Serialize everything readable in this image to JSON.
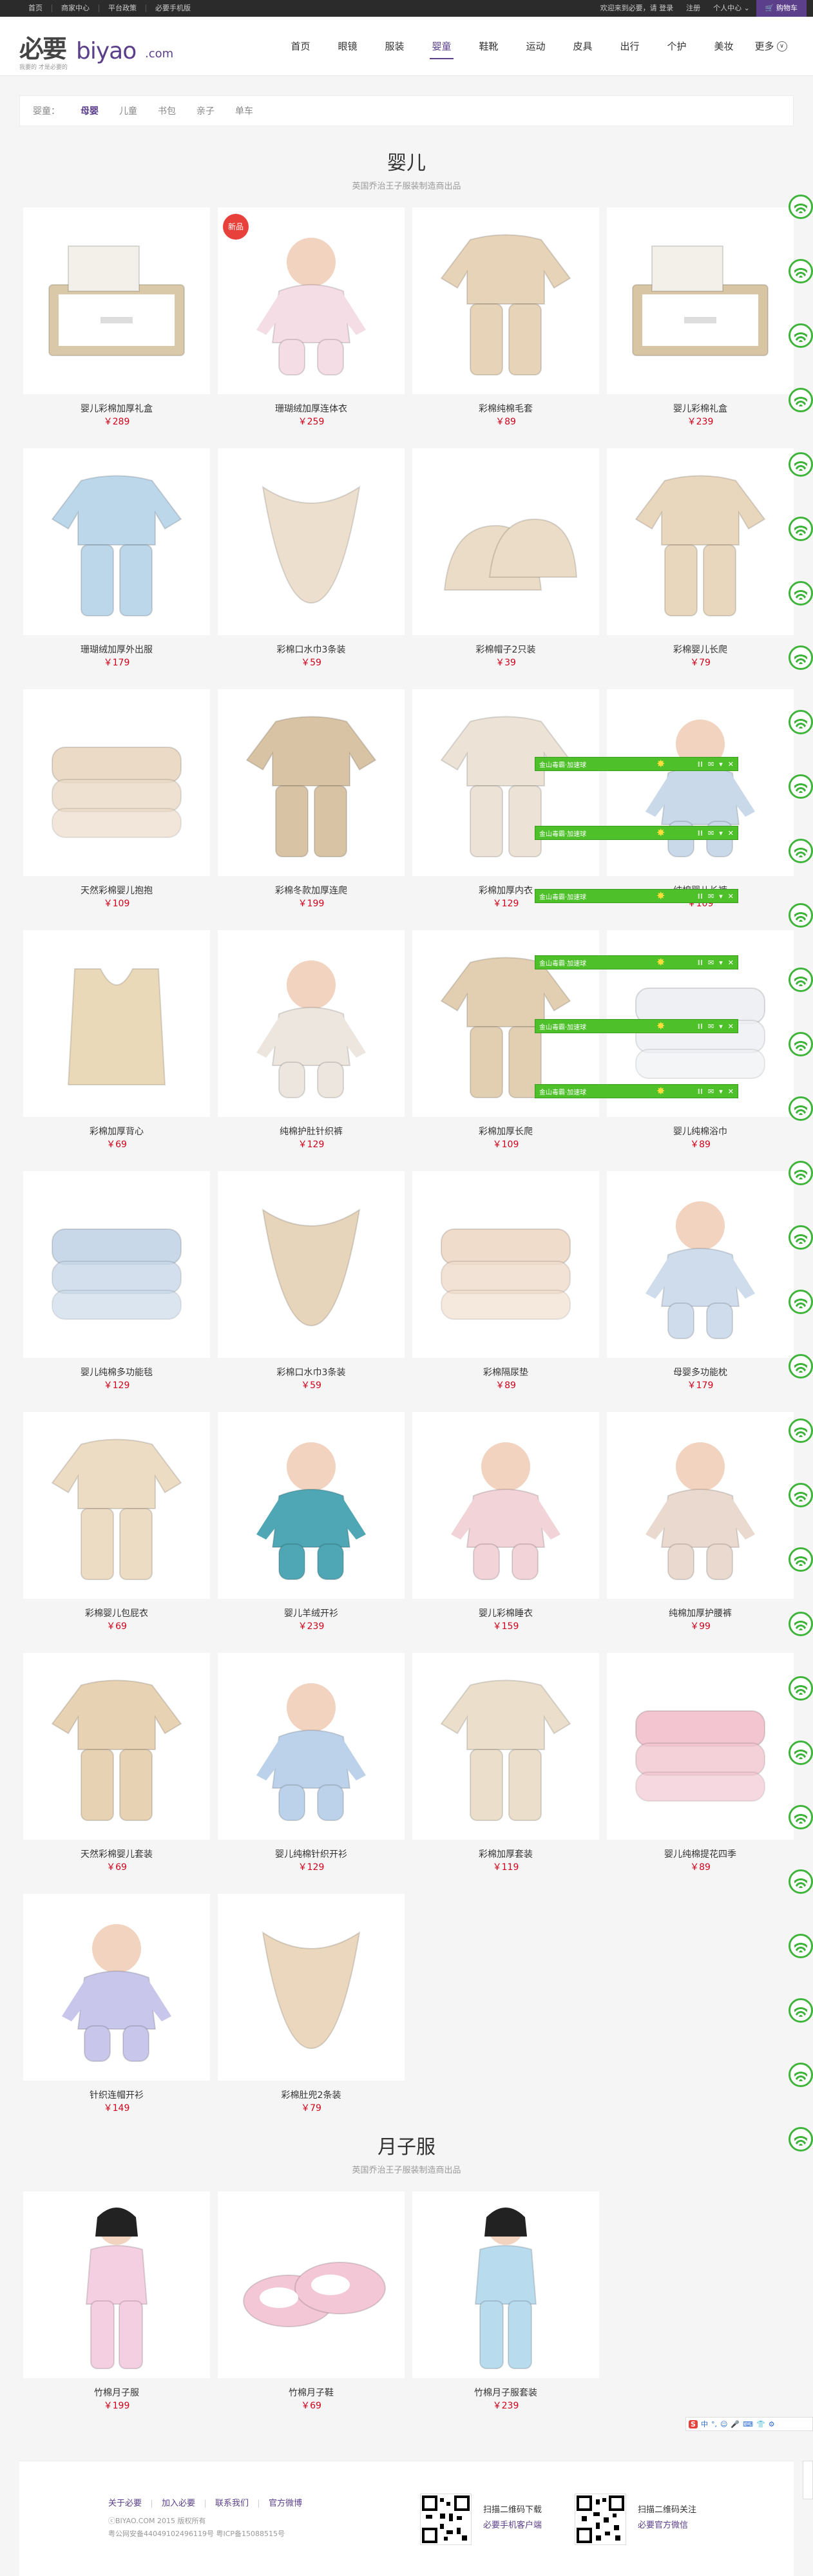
{
  "topbar": {
    "left": [
      "首页",
      "商家中心",
      "平台政策",
      "必要手机版"
    ],
    "right": [
      "欢迎来到必要，请  登录",
      "注册",
      "个人中心 ⌄"
    ],
    "cart": "🛒 购物车"
  },
  "logo": {
    "cn": "必要",
    "en": "biyao",
    "com": ".com",
    "sub": "我要的 才是必要的"
  },
  "nav": {
    "items": [
      "首页",
      "眼镜",
      "服装",
      "婴童",
      "鞋靴",
      "运动",
      "皮具",
      "出行",
      "个护",
      "美妆"
    ],
    "active": "婴童",
    "more": "更多"
  },
  "breadcrumb": {
    "label": "婴童：",
    "items": [
      "母婴",
      "儿童",
      "书包",
      "亲子",
      "单车"
    ],
    "active": "母婴"
  },
  "section1": {
    "title": "婴儿",
    "subtitle": "英国乔治王子服装制造商出品"
  },
  "section2": {
    "title": "月子服",
    "subtitle": "英国乔治王子服装制造商出品"
  },
  "badge_new": "新品",
  "products1": [
    {
      "name": "婴儿彩棉加厚礼盒",
      "price": "￥289",
      "icon": "gift-box",
      "color": "#d9c9a8"
    },
    {
      "name": "珊瑚绒加厚连体衣",
      "price": "￥259",
      "icon": "pink-onesie",
      "color": "#f4dde4",
      "badge": true
    },
    {
      "name": "彩棉纯棉毛套",
      "price": "￥89",
      "icon": "beige-set",
      "color": "#e6d3b8"
    },
    {
      "name": "婴儿彩棉礼盒",
      "price": "￥239",
      "icon": "gift-box",
      "color": "#d8c5a4"
    },
    {
      "name": "珊瑚绒加厚外出服",
      "price": "￥179",
      "icon": "blue-jacket",
      "color": "#bcd6ea"
    },
    {
      "name": "彩棉口水巾3条装",
      "price": "￥59",
      "icon": "bibs",
      "color": "#ecdfcd"
    },
    {
      "name": "彩棉帽子2只装",
      "price": "￥39",
      "icon": "hats",
      "color": "#eadcc6"
    },
    {
      "name": "彩棉婴儿长爬",
      "price": "￥79",
      "icon": "romper",
      "color": "#e8d6bd"
    },
    {
      "name": "天然彩棉婴儿抱抱",
      "price": "￥109",
      "icon": "wrap",
      "color": "#eadac6"
    },
    {
      "name": "彩棉冬款加厚连爬",
      "price": "￥199",
      "icon": "hooded-romper",
      "color": "#d8c3a5"
    },
    {
      "name": "彩棉加厚内衣",
      "price": "￥129",
      "icon": "underwear",
      "color": "#ece3d6"
    },
    {
      "name": "纯棉婴儿长裤",
      "price": "￥109",
      "icon": "baby-play",
      "color": "#c9d9ea"
    },
    {
      "name": "彩棉加厚背心",
      "price": "￥69",
      "icon": "vest",
      "color": "#ead9b8"
    },
    {
      "name": "纯棉护肚针织裤",
      "price": "￥129",
      "icon": "baby-hat",
      "color": "#ece6de"
    },
    {
      "name": "彩棉加厚长爬",
      "price": "￥109",
      "icon": "romper",
      "color": "#e2cfb2"
    },
    {
      "name": "婴儿纯棉浴巾",
      "price": "￥89",
      "icon": "towels",
      "color": "#eef0f4"
    },
    {
      "name": "婴儿纯棉多功能毯",
      "price": "￥129",
      "icon": "blankets",
      "color": "#c9d8e8"
    },
    {
      "name": "彩棉口水巾3条装",
      "price": "￥59",
      "icon": "bandana",
      "color": "#e6d4bb"
    },
    {
      "name": "彩棉隔尿垫",
      "price": "￥89",
      "icon": "pad",
      "color": "#f0dccb"
    },
    {
      "name": "母婴多功能枕",
      "price": "￥179",
      "icon": "pillow",
      "color": "#cfdcec"
    },
    {
      "name": "彩棉婴儿包屁衣",
      "price": "￥69",
      "icon": "bodysuit",
      "color": "#eddcc4"
    },
    {
      "name": "婴儿羊绒开衫",
      "price": "￥239",
      "icon": "teal-cardigan",
      "color": "#4fa6b4"
    },
    {
      "name": "婴儿彩棉睡衣",
      "price": "￥159",
      "icon": "pink-pajama",
      "color": "#f1d3d8"
    },
    {
      "name": "纯棉加厚护腰裤",
      "price": "￥99",
      "icon": "baby-table",
      "color": "#e9d9ce"
    },
    {
      "name": "天然彩棉婴儿套装",
      "price": "￥69",
      "icon": "beige-set",
      "color": "#e7d2b4"
    },
    {
      "name": "婴儿纯棉针织开衫",
      "price": "￥129",
      "icon": "blue-cardigan",
      "color": "#bcd2ea"
    },
    {
      "name": "彩棉加厚套装",
      "price": "￥119",
      "icon": "padded-set",
      "color": "#ebdfcc"
    },
    {
      "name": "婴儿纯棉提花四季",
      "price": "￥89",
      "icon": "pink-blanket",
      "color": "#f2c5d0"
    },
    {
      "name": "针织连帽开衫",
      "price": "￥149",
      "icon": "lavender-hoodie",
      "color": "#c8c6ea"
    },
    {
      "name": "彩棉肚兜2条装",
      "price": "￥79",
      "icon": "bib-apron",
      "color": "#ead7bd"
    }
  ],
  "products2": [
    {
      "name": "竹棉月子服",
      "price": "￥199",
      "icon": "mom-pajama-pink",
      "color": "#f4cfe1"
    },
    {
      "name": "竹棉月子鞋",
      "price": "￥69",
      "icon": "slippers",
      "color": "#f3c7d6"
    },
    {
      "name": "竹棉月子服套装",
      "price": "￥239",
      "icon": "mom-pajama-blue",
      "color": "#b9dbee"
    }
  ],
  "overlay": {
    "label": "金山毒霸·加速球",
    "icons": [
      "⁞⁞",
      "✉",
      "▾",
      "✕"
    ]
  },
  "imebar": {
    "s": "S",
    "items": [
      "中",
      "°,",
      "☺",
      "🎤",
      "⌨",
      "👕",
      "⚙"
    ]
  },
  "footer": {
    "links": [
      "关于必要",
      "加入必要",
      "联系我们",
      "官方微博"
    ],
    "copyright": "ⓒBIYAO.COM 2015 版权所有",
    "beian": "粤公网安备44049102496119号  粤ICP备15088515号",
    "qr1_title": "扫描二维码下载",
    "qr1_link": "必要手机客户端",
    "qr2_title": "扫描二维码关注",
    "qr2_link": "必要官方微信"
  }
}
